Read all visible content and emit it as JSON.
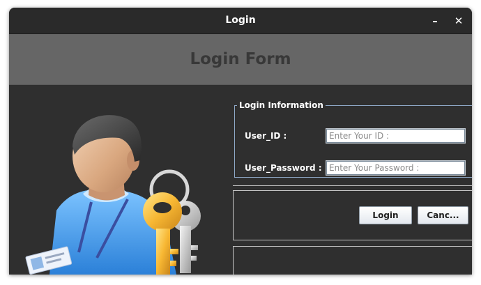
{
  "window": {
    "title": "Login",
    "minimize_glyph": "–",
    "close_glyph": "✕"
  },
  "header": {
    "title": "Login Form"
  },
  "login_info": {
    "legend": "Login Information",
    "user_id_label": "User_ID :",
    "user_id_placeholder": "Enter Your ID :",
    "user_id_value": "",
    "password_label": "User_Password :",
    "password_placeholder": "Enter Your Password :",
    "password_value": ""
  },
  "actions": {
    "login_label": "Login",
    "cancel_label": "Canc..."
  },
  "icons": {
    "illustration": "user-with-keys-icon"
  },
  "colors": {
    "window_bg": "#2f2f2f",
    "titlebar_bg": "#2a2a2a",
    "header_band": "#666666",
    "header_text": "#383838",
    "fieldset_border": "#8fa9c7"
  }
}
